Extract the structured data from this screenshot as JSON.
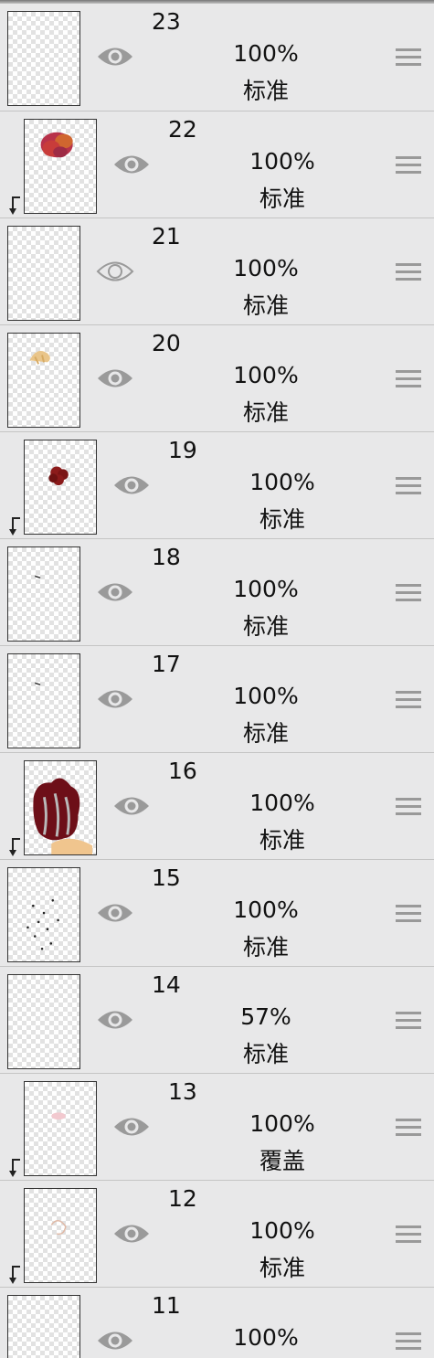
{
  "layers": [
    {
      "name": "23",
      "opacity": "100%",
      "blend": "标准",
      "visible": true,
      "clipped": false,
      "thumb": "empty"
    },
    {
      "name": "22",
      "opacity": "100%",
      "blend": "标准",
      "visible": true,
      "clipped": true,
      "thumb": "red-blob"
    },
    {
      "name": "21",
      "opacity": "100%",
      "blend": "标准",
      "visible": false,
      "clipped": false,
      "thumb": "empty"
    },
    {
      "name": "20",
      "opacity": "100%",
      "blend": "标准",
      "visible": true,
      "clipped": false,
      "thumb": "tan-shape"
    },
    {
      "name": "19",
      "opacity": "100%",
      "blend": "标准",
      "visible": true,
      "clipped": true,
      "thumb": "small-dark-red"
    },
    {
      "name": "18",
      "opacity": "100%",
      "blend": "标准",
      "visible": true,
      "clipped": false,
      "thumb": "speck"
    },
    {
      "name": "17",
      "opacity": "100%",
      "blend": "标准",
      "visible": true,
      "clipped": false,
      "thumb": "speck"
    },
    {
      "name": "16",
      "opacity": "100%",
      "blend": "标准",
      "visible": true,
      "clipped": true,
      "thumb": "dark-red-hair"
    },
    {
      "name": "15",
      "opacity": "100%",
      "blend": "标准",
      "visible": true,
      "clipped": false,
      "thumb": "dots"
    },
    {
      "name": "14",
      "opacity": "57%",
      "blend": "标准",
      "visible": true,
      "clipped": false,
      "thumb": "empty"
    },
    {
      "name": "13",
      "opacity": "100%",
      "blend": "覆盖",
      "visible": true,
      "clipped": true,
      "thumb": "faint-pink"
    },
    {
      "name": "12",
      "opacity": "100%",
      "blend": "标准",
      "visible": true,
      "clipped": true,
      "thumb": "faint-sketch"
    },
    {
      "name": "11",
      "opacity": "100%",
      "blend": "",
      "visible": true,
      "clipped": false,
      "thumb": "empty"
    }
  ],
  "icons": {
    "eye": "eye-icon",
    "eye_hidden": "eye-outline-icon",
    "handle": "drag-handle-icon",
    "clip": "clipping-arrow-icon"
  },
  "colors": {
    "panel_bg": "#e8e8e9",
    "divider": "#c4c4c4",
    "icon_gray": "#999999",
    "text": "#111111"
  }
}
